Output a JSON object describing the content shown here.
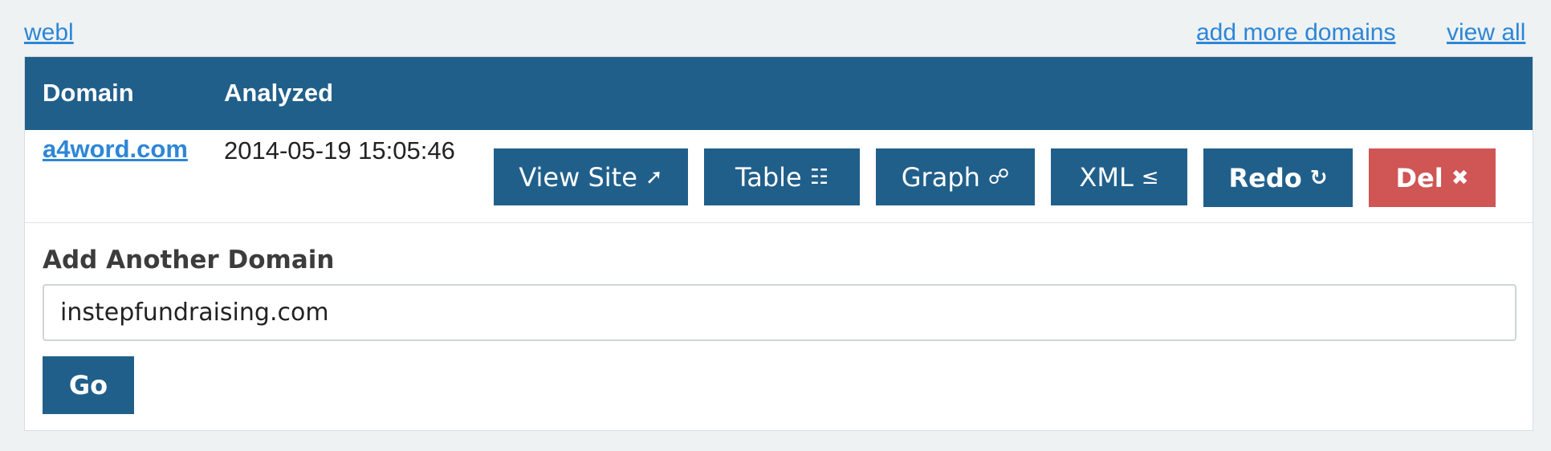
{
  "top_nav": {
    "left_link": "webl",
    "add_more_link": "add more domains",
    "view_all_link": "view all"
  },
  "table": {
    "headers": {
      "domain": "Domain",
      "analyzed": "Analyzed"
    },
    "rows": [
      {
        "domain": "a4word.com",
        "analyzed": "2014-05-19 15:05:46",
        "actions": [
          {
            "label": "View Site",
            "icon": "external-arrow-icon",
            "glyph": "➚"
          },
          {
            "label": "Table",
            "icon": "table-icon",
            "glyph": "☷"
          },
          {
            "label": "Graph",
            "icon": "graph-icon",
            "glyph": "☍"
          },
          {
            "label": "XML",
            "icon": "xml-icon",
            "glyph": "≤"
          },
          {
            "label": "Redo",
            "icon": "redo-icon",
            "glyph": "↻"
          },
          {
            "label": "Del",
            "icon": "delete-icon",
            "glyph": "✖"
          }
        ]
      }
    ]
  },
  "add_domain": {
    "label": "Add Another Domain",
    "input_value": "instepfundraising.com",
    "submit_label": "Go"
  },
  "colors": {
    "primary": "#215f8b",
    "danger": "#d05555",
    "link": "#2e86d6",
    "background": "#eef2f3"
  }
}
